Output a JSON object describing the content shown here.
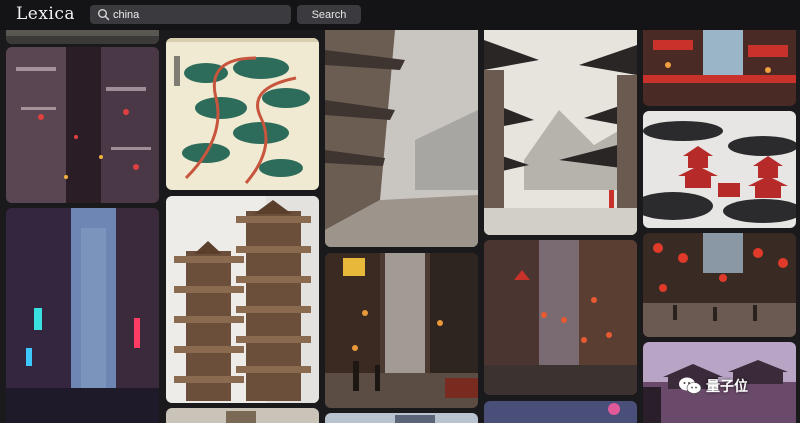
{
  "app": {
    "logo": "Lexica"
  },
  "search": {
    "value": "china",
    "button_label": "Search"
  },
  "watermark": {
    "text": "量子位"
  },
  "gallery": {
    "images": [
      "cyberpunk-city-night-street",
      "ink-pine-tree-scroll-painting",
      "foggy-ancient-chinese-street",
      "chinese-rooftops-mountain-ink-painting",
      "red-lantern-pagoda-town",
      "ink-red-pagoda-landscape",
      "neon-cyberpunk-alley",
      "twin-pagoda-towers",
      "rainy-chinatown-street",
      "lantern-lit-old-town-street",
      "red-lanterns-festival-square",
      "palace-roofs-dusk",
      "partial-tile-bottom-left",
      "partial-tile-bottom-center",
      "partial-tile-bottom-right"
    ]
  }
}
